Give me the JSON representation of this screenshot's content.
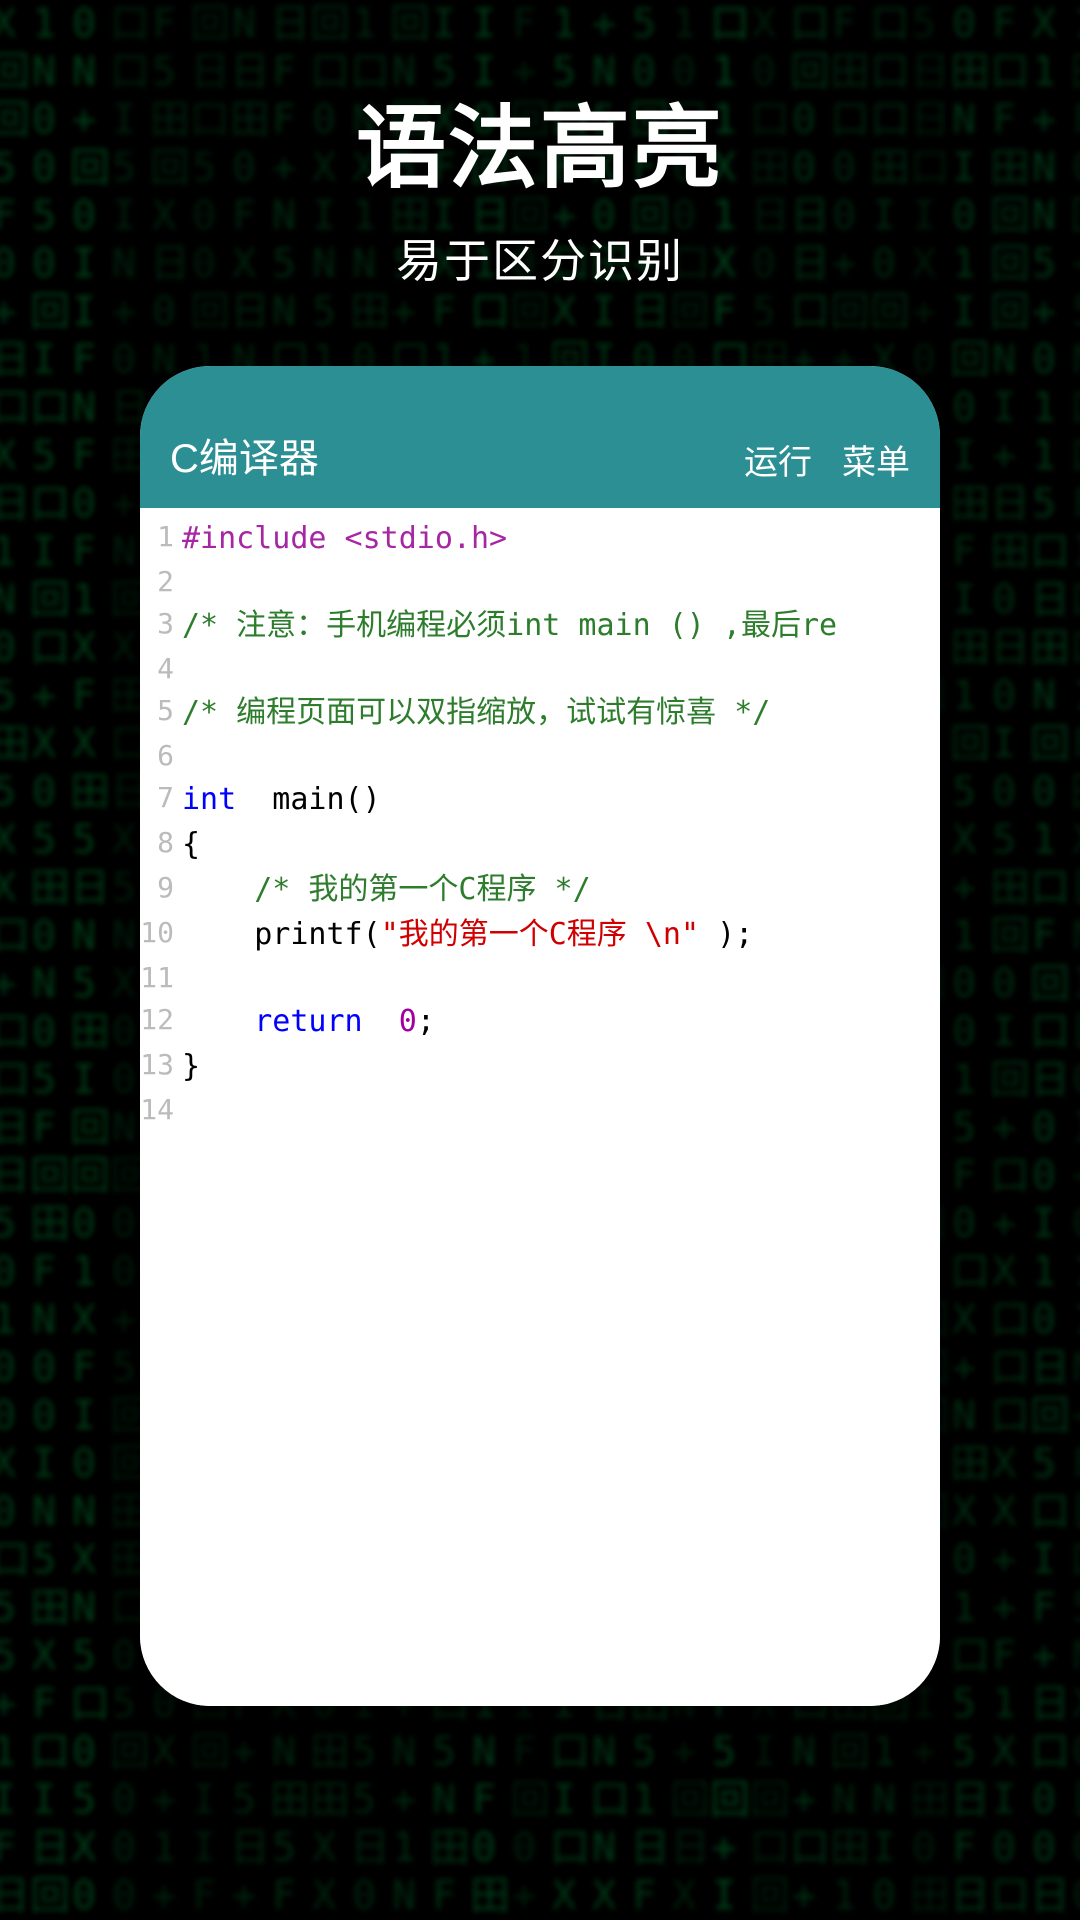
{
  "page": {
    "title": "语法高亮",
    "subtitle": "易于区分识别"
  },
  "app": {
    "title": "C编译器",
    "actions": {
      "run": "运行",
      "menu": "菜单"
    }
  },
  "code": {
    "lines": [
      {
        "num": "1",
        "tokens": [
          {
            "t": "#include <stdio.h>",
            "c": "tok-preproc"
          }
        ]
      },
      {
        "num": "2",
        "tokens": []
      },
      {
        "num": "3",
        "tokens": [
          {
            "t": "/* 注意：手机编程必须int main () ,最后re",
            "c": "tok-comment"
          }
        ]
      },
      {
        "num": "4",
        "tokens": []
      },
      {
        "num": "5",
        "tokens": [
          {
            "t": "/* 编程页面可以双指缩放，试试有惊喜 */",
            "c": "tok-comment"
          }
        ]
      },
      {
        "num": "6",
        "tokens": []
      },
      {
        "num": "7",
        "tokens": [
          {
            "t": "int",
            "c": "tok-keyword"
          },
          {
            "t": "  main()",
            "c": "tok-plain"
          }
        ]
      },
      {
        "num": "8",
        "tokens": [
          {
            "t": "{",
            "c": "tok-plain"
          }
        ]
      },
      {
        "num": "9",
        "tokens": [
          {
            "t": "    ",
            "c": "tok-plain"
          },
          {
            "t": "/* 我的第一个C程序 */",
            "c": "tok-comment"
          }
        ]
      },
      {
        "num": "10",
        "tokens": [
          {
            "t": "    printf(",
            "c": "tok-plain"
          },
          {
            "t": "\"我的第一个C程序 \\n\"",
            "c": "tok-string"
          },
          {
            "t": " );",
            "c": "tok-plain"
          }
        ]
      },
      {
        "num": "11",
        "tokens": []
      },
      {
        "num": "12",
        "tokens": [
          {
            "t": "    ",
            "c": "tok-plain"
          },
          {
            "t": "return",
            "c": "tok-keyword"
          },
          {
            "t": "  ",
            "c": "tok-plain"
          },
          {
            "t": "0",
            "c": "tok-number"
          },
          {
            "t": ";",
            "c": "tok-plain"
          }
        ]
      },
      {
        "num": "13",
        "tokens": [
          {
            "t": "}",
            "c": "tok-plain"
          }
        ]
      },
      {
        "num": "14",
        "tokens": []
      }
    ]
  },
  "matrix_chars": "口日0X+FNI105田回"
}
